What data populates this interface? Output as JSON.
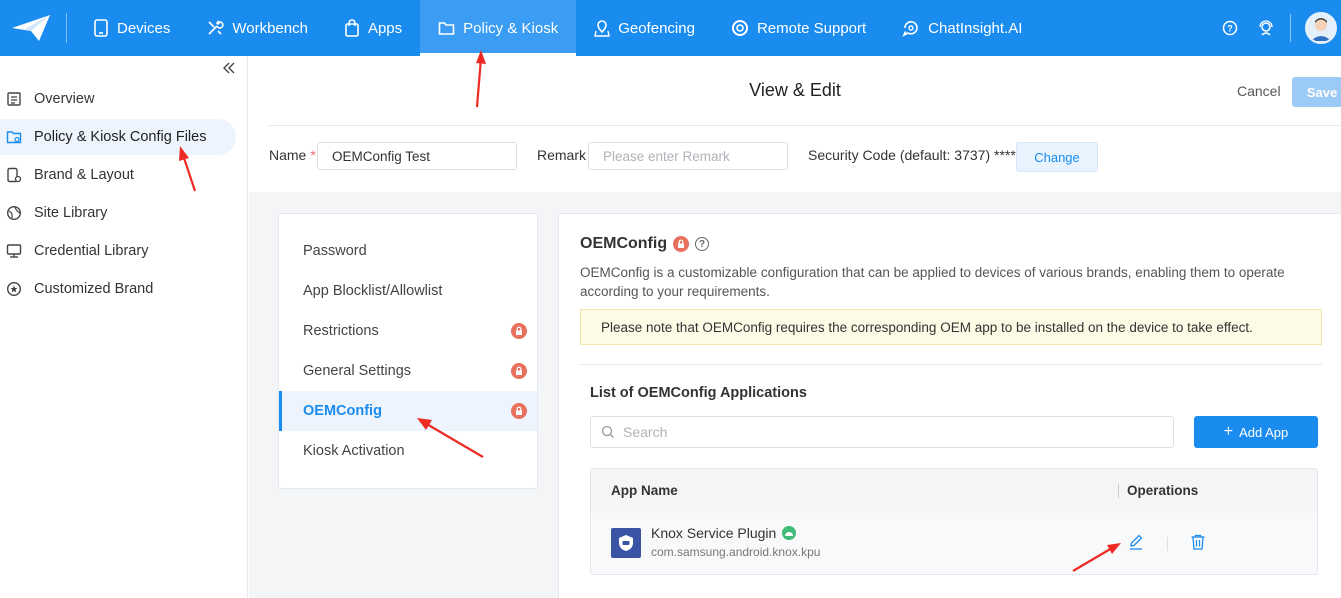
{
  "topbar": {
    "nav": [
      {
        "label": "Devices",
        "icon": "tablet-icon"
      },
      {
        "label": "Workbench",
        "icon": "tools-icon"
      },
      {
        "label": "Apps",
        "icon": "bag-icon"
      },
      {
        "label": "Policy & Kiosk",
        "icon": "folder-icon",
        "active": true
      },
      {
        "label": "Geofencing",
        "icon": "map-pin-icon"
      },
      {
        "label": "Remote Support",
        "icon": "lifebuoy-icon"
      },
      {
        "label": "ChatInsight.AI",
        "icon": "ai-chat-icon"
      }
    ],
    "accent": "#1a8cf0"
  },
  "sidebar": {
    "items": [
      {
        "label": "Overview",
        "icon": "list-icon"
      },
      {
        "label": "Policy & Kiosk Config Files",
        "icon": "config-folder-icon",
        "active": true
      },
      {
        "label": "Brand & Layout",
        "icon": "device-gear-icon"
      },
      {
        "label": "Site Library",
        "icon": "globe-icon"
      },
      {
        "label": "Credential Library",
        "icon": "monitor-icon"
      },
      {
        "label": "Customized Brand",
        "icon": "star-circle-icon"
      }
    ]
  },
  "header": {
    "title": "View & Edit",
    "cancel_label": "Cancel",
    "save_label": "Save"
  },
  "form": {
    "name_label": "Name",
    "name_required": "*",
    "name_value": "OEMConfig Test",
    "remark_label": "Remark",
    "remark_placeholder": "Please enter Remark",
    "security_label": "Security Code (default: 3737) ****",
    "change_label": "Change"
  },
  "menu": {
    "items": [
      {
        "label": "Password",
        "locked": false
      },
      {
        "label": "App Blocklist/Allowlist",
        "locked": false
      },
      {
        "label": "Restrictions",
        "locked": true
      },
      {
        "label": "General Settings",
        "locked": true
      },
      {
        "label": "OEMConfig",
        "locked": true,
        "active": true
      },
      {
        "label": "Kiosk Activation",
        "locked": false
      }
    ]
  },
  "oemconfig": {
    "title": "OEMConfig",
    "help": "?",
    "description": "OEMConfig is a customizable configuration that can be applied to devices of various brands, enabling them to operate according to your requirements.",
    "notice": "Please note that OEMConfig requires the corresponding OEM app to be installed on the device to take effect.",
    "list_title": "List of OEMConfig Applications",
    "search_placeholder": "Search",
    "add_app_label": "Add App",
    "table": {
      "columns": [
        "App Name",
        "Operations"
      ],
      "rows": [
        {
          "name": "Knox Service Plugin",
          "package": "com.samsung.android.knox.kpu"
        }
      ]
    }
  }
}
